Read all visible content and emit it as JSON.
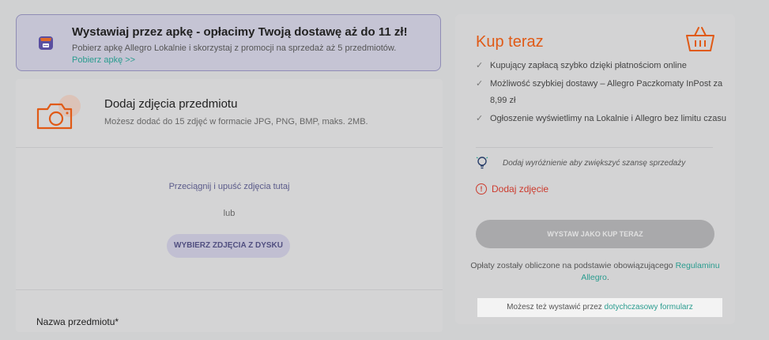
{
  "banner": {
    "title": "Wystawiaj przez apkę - opłacimy Twoją dostawę aż do 11 zł!",
    "description": "Pobierz apkę Allegro Lokalnie i skorzystaj z promocji na sprzedaż aż 5 przedmiotów.",
    "link": "Pobierz apkę >>",
    "icon": "shop-app-icon"
  },
  "photos": {
    "title": "Dodaj zdjęcia przedmiotu",
    "description": "Możesz dodać do 15 zdjęć w formacie JPG, PNG, BMP, maks. 2MB.",
    "drop_text": "Przeciągnij i upuść zdjęcia tutaj",
    "or_text": "lub",
    "choose_button": "WYBIERZ ZDJĘCIA Z DYSKU",
    "icon": "camera-icon"
  },
  "form": {
    "name_label": "Nazwa przedmiotu*"
  },
  "buy_now": {
    "title": "Kup teraz",
    "icon": "basket-icon",
    "features": [
      "Kupujący zapłacą szybko dzięki płatnościom online",
      "Możliwość szybkiej dostawy – Allegro Paczkomaty InPost za 8,99 zł",
      "Ogłoszenie wyświetlimy na Lokalnie i Allegro bez limitu czasu"
    ],
    "promo_tip": "Dodaj wyróżnienie aby zwiększyć szansę sprzedaży",
    "warning": "Dodaj zdjęcie",
    "submit_button": "WYSTAW JAKO KUP TERAZ",
    "fees_text": "Opłaty zostały obliczone na podstawie obowiązującego",
    "fees_link": "Regulaminu Allegro",
    "fees_end": ".",
    "old_form_text": "Możesz też wystawić przez",
    "old_form_link": "dotychczasowy formularz"
  },
  "colors": {
    "accent_orange": "#e05a16",
    "link_teal": "#2a9c8f",
    "error_red": "#cc3b2e",
    "banner_border": "#8f8cb5"
  }
}
